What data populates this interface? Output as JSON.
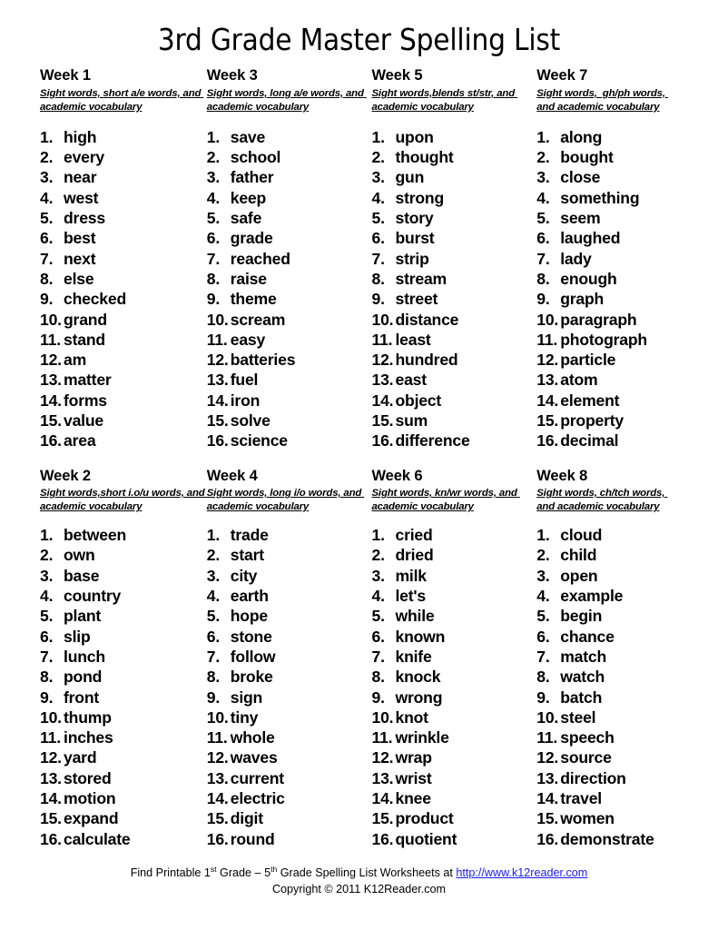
{
  "document": {
    "title": "3rd Grade Master Spelling List"
  },
  "columns": [
    {
      "top": {
        "title": "Week 1",
        "subtitle": "Sight words, short a/e words, and academic vocabulary",
        "words": [
          "high",
          "every",
          "near",
          "west",
          "dress",
          "best",
          "next",
          "else",
          "checked",
          "grand",
          "stand",
          "am",
          "matter",
          "forms",
          "value",
          "area"
        ]
      },
      "bottom": {
        "title": "Week 2",
        "subtitle": "Sight words,short i.o/u words, and academic vocabulary",
        "words": [
          "between",
          "own",
          "base",
          "country",
          "plant",
          "slip",
          "lunch",
          "pond",
          "front",
          "thump",
          "inches",
          "yard",
          "stored",
          "motion",
          "expand",
          "calculate"
        ]
      }
    },
    {
      "top": {
        "title": "Week 3",
        "subtitle": "Sight words, long a/e words, and academic vocabulary",
        "words": [
          "save",
          "school",
          "father",
          "keep",
          "safe",
          "grade",
          "reached",
          "raise",
          "theme",
          "scream",
          "easy",
          "batteries",
          "fuel",
          "iron",
          "solve",
          "science"
        ]
      },
      "bottom": {
        "title": "Week 4",
        "subtitle": "Sight words, long i/o words, and academic vocabulary",
        "words": [
          "trade",
          "start",
          "city",
          "earth",
          "hope",
          "stone",
          "follow",
          "broke",
          "sign",
          "tiny",
          "whole",
          "waves",
          "current",
          "electric",
          "digit",
          "round"
        ]
      }
    },
    {
      "top": {
        "title": "Week 5",
        "subtitle": "Sight words,blends st/str, and academic vocabulary",
        "words": [
          "upon",
          "thought",
          "gun",
          "strong",
          "story",
          "burst",
          "strip",
          "stream",
          "street",
          "distance",
          "least",
          "hundred",
          "east",
          "object",
          "sum",
          "difference"
        ]
      },
      "bottom": {
        "title": "Week 6",
        "subtitle": "Sight words, kn/wr words, and academic vocabulary",
        "words": [
          "cried",
          "dried",
          "milk",
          "let's",
          "while",
          "known",
          "knife",
          "knock",
          "wrong",
          "knot",
          "wrinkle",
          "wrap",
          "wrist",
          "knee",
          "product",
          "quotient"
        ]
      }
    },
    {
      "top": {
        "title": "Week 7",
        "subtitle": "Sight words,  gh/ph words, and academic vocabulary",
        "words": [
          "along",
          "bought",
          "close",
          "something",
          "seem",
          "laughed",
          "lady",
          "enough",
          "graph",
          "paragraph",
          "photograph",
          "particle",
          "atom",
          "element",
          "property",
          "decimal"
        ]
      },
      "bottom": {
        "title": "Week 8",
        "subtitle": "Sight words, ch/tch words, and academic vocabulary",
        "words": [
          "cloud",
          "child",
          "open",
          "example",
          "begin",
          "chance",
          "match",
          "watch",
          "batch",
          "steel",
          "speech",
          "source",
          "direction",
          "travel",
          "women",
          "demonstrate"
        ]
      }
    }
  ],
  "footer": {
    "line1_before_link": "Find Printable 1",
    "line1_sup1": "st",
    "line1_mid1": " Grade – 5",
    "line1_sup2": "th",
    "line1_mid2": " Grade Spelling List Worksheets at ",
    "line1_link": "http://www.k12reader.com",
    "line2": "Copyright © 2011 K12Reader.com",
    "link_color": "#1a1aee"
  }
}
